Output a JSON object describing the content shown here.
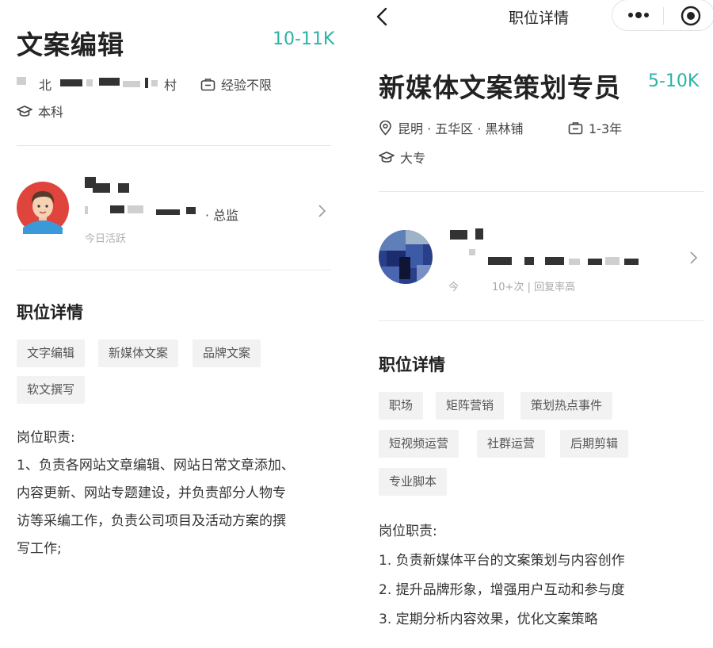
{
  "left": {
    "job_title": "文案编辑",
    "salary": "10-11K",
    "location_suffix": "北",
    "location_tail": "村",
    "experience": "经验不限",
    "education": "本科",
    "boss_title": "总监",
    "boss_active": "今日活跃",
    "section_title": "职位详情",
    "tags": [
      "文字编辑",
      "新媒体文案",
      "品牌文案",
      "软文撰写"
    ],
    "duty_heading": "岗位职责:",
    "duty_lines": [
      "1、负责各网站文章编辑、网站日常文章添加、",
      "内容更新、网站专题建设，并负责部分人物专",
      "访等采编工作，负责公司项目及活动方案的撰",
      "写工作;"
    ]
  },
  "right": {
    "nav_title": "职位详情",
    "back_icon": "back-arrow-icon",
    "job_title": "新媒体文案策划专员",
    "salary": "5-10K",
    "location": "昆明 · 五华区 · 黑林铺",
    "experience": "1-3年",
    "education": "大专",
    "boss_stats_prefix": "今",
    "boss_stats": "10+次 | 回复率高",
    "section_title": "职位详情",
    "tags": [
      "职场",
      "矩阵营销",
      "策划热点事件",
      "短视频运营",
      "社群运营",
      "后期剪辑",
      "专业脚本"
    ],
    "duty_heading": "岗位职责:",
    "duty_lines": [
      "1. 负责新媒体平台的文案策划与内容创作",
      "2. 提升品牌形象，增强用户互动和参与度",
      "3. 定期分析内容效果，优化文案策略"
    ]
  },
  "colors": {
    "salary": "#2ab3a6",
    "tag_bg": "#f2f2f2",
    "divider": "#e8e8e8"
  }
}
